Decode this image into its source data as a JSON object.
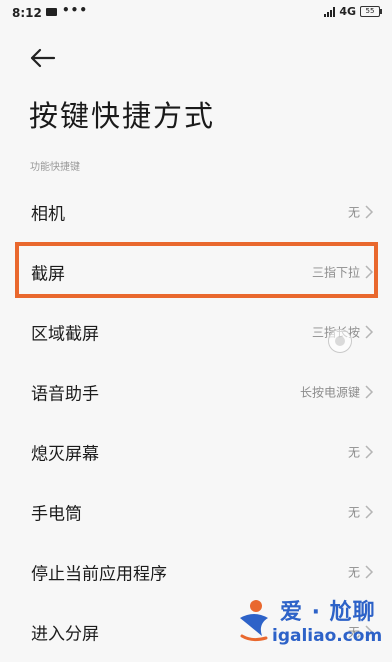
{
  "status_bar": {
    "time": "8:12",
    "more": "•••",
    "network": "4G",
    "battery": "55"
  },
  "header": {
    "title": "按键快捷方式"
  },
  "section_label": "功能快捷键",
  "rows": [
    {
      "label": "相机",
      "value": "无"
    },
    {
      "label": "截屏",
      "value": "三指下拉"
    },
    {
      "label": "区域截屏",
      "value": "三指长按"
    },
    {
      "label": "语音助手",
      "value": "长按电源键"
    },
    {
      "label": "熄灭屏幕",
      "value": "无"
    },
    {
      "label": "手电筒",
      "value": "无"
    },
    {
      "label": "停止当前应用程序",
      "value": "无"
    },
    {
      "label": "进入分屏",
      "value": "无"
    }
  ],
  "watermark": {
    "title": "爱 · 尬聊",
    "url": "igaliao.com"
  },
  "colors": {
    "highlight": "#e9682e",
    "watermark": "#2d62c8",
    "background": "#f7f7f7"
  },
  "icons": [
    "back-arrow-icon",
    "chevron-right-icon",
    "signal-icon",
    "battery-icon"
  ]
}
